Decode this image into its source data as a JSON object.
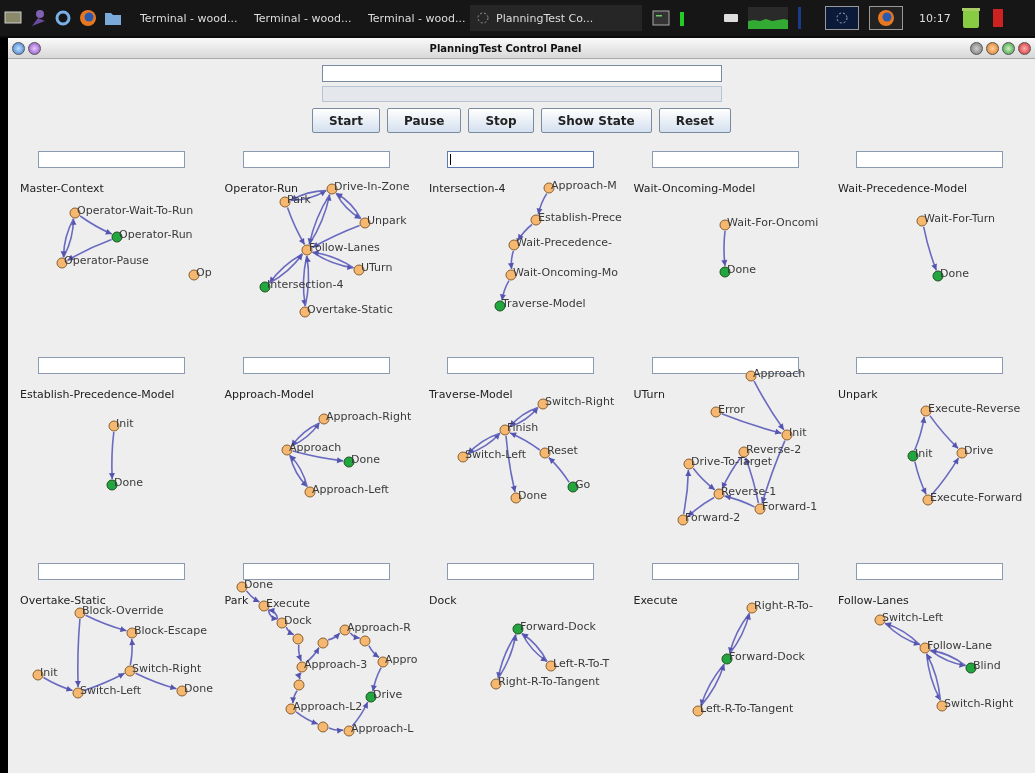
{
  "taskbar": {
    "tasks": [
      {
        "label": "Terminal - wood...",
        "kind": "terminal",
        "selected": false
      },
      {
        "label": "Terminal - wood...",
        "kind": "terminal",
        "selected": false
      },
      {
        "label": "Terminal - wood...",
        "kind": "terminal",
        "selected": false
      },
      {
        "label": "PlanningTest Co...",
        "kind": "java",
        "selected": true
      }
    ],
    "clock": "10:17"
  },
  "window": {
    "title": "PlanningTest Control Panel"
  },
  "buttons": [
    "Start",
    "Pause",
    "Stop",
    "Show State",
    "Reset"
  ],
  "panels": [
    {
      "title": "Master-Context",
      "field_focused": false,
      "nodes": [
        {
          "label": "Operator-Wait-To-Run",
          "active": false
        },
        {
          "label": "Operator-Run",
          "active": true
        },
        {
          "label": "Operator-Pause",
          "active": false
        },
        {
          "label": "Op",
          "active": false
        }
      ]
    },
    {
      "title": "Operator-Run",
      "field_focused": false,
      "nodes": [
        {
          "label": "Park",
          "active": false
        },
        {
          "label": "Drive-In-Zone",
          "active": false
        },
        {
          "label": "Unpark",
          "active": false
        },
        {
          "label": "Follow-Lanes",
          "active": false
        },
        {
          "label": "UTurn",
          "active": false
        },
        {
          "label": "Intersection-4",
          "active": true
        },
        {
          "label": "Overtake-Static",
          "active": false
        }
      ]
    },
    {
      "title": "Intersection-4",
      "field_focused": true,
      "nodes": [
        {
          "label": "Approach-M",
          "active": false
        },
        {
          "label": "Establish-Prece",
          "active": false
        },
        {
          "label": "Wait-Precedence-",
          "active": false
        },
        {
          "label": "Wait-Oncoming-Mo",
          "active": false
        },
        {
          "label": "Traverse-Model",
          "active": true
        }
      ]
    },
    {
      "title": "Wait-Oncoming-Model",
      "field_focused": false,
      "nodes": [
        {
          "label": "Wait-For-Oncomi",
          "active": false
        },
        {
          "label": "Done",
          "active": true
        }
      ]
    },
    {
      "title": "Wait-Precedence-Model",
      "field_focused": false,
      "nodes": [
        {
          "label": "Wait-For-Turn",
          "active": false
        },
        {
          "label": "Done",
          "active": true
        }
      ]
    },
    {
      "title": "Establish-Precedence-Model",
      "field_focused": false,
      "nodes": [
        {
          "label": "Init",
          "active": false
        },
        {
          "label": "Done",
          "active": true
        }
      ]
    },
    {
      "title": "Approach-Model",
      "field_focused": false,
      "nodes": [
        {
          "label": "Approach-Right",
          "active": false
        },
        {
          "label": "Approach",
          "active": false
        },
        {
          "label": "Done",
          "active": true
        },
        {
          "label": "Approach-Left",
          "active": false
        }
      ]
    },
    {
      "title": "Traverse-Model",
      "field_focused": false,
      "nodes": [
        {
          "label": "Switch-Right",
          "active": false
        },
        {
          "label": "Finish",
          "active": false
        },
        {
          "label": "Switch-Left",
          "active": false
        },
        {
          "label": "Reset",
          "active": false
        },
        {
          "label": "Done",
          "active": false
        },
        {
          "label": "Go",
          "active": true
        }
      ]
    },
    {
      "title": "UTurn",
      "field_focused": false,
      "nodes": [
        {
          "label": "Approach",
          "active": false
        },
        {
          "label": "Error",
          "active": false
        },
        {
          "label": "Init",
          "active": false
        },
        {
          "label": "Drive-To-Target",
          "active": false
        },
        {
          "label": "Reverse-2",
          "active": false
        },
        {
          "label": "Reverse-1",
          "active": false
        },
        {
          "label": "Forward-1",
          "active": false
        },
        {
          "label": "Forward-2",
          "active": false
        }
      ]
    },
    {
      "title": "Unpark",
      "field_focused": false,
      "nodes": [
        {
          "label": "Execute-Reverse",
          "active": false
        },
        {
          "label": "Init",
          "active": true
        },
        {
          "label": "Drive",
          "active": false
        },
        {
          "label": "Execute-Forward",
          "active": false
        }
      ]
    },
    {
      "title": "Overtake-Static",
      "field_focused": false,
      "nodes": [
        {
          "label": "Block-Override",
          "active": false
        },
        {
          "label": "Block-Escape",
          "active": false
        },
        {
          "label": "Init",
          "active": false
        },
        {
          "label": "Switch-Left",
          "active": false
        },
        {
          "label": "Switch-Right",
          "active": false
        },
        {
          "label": "Done",
          "active": false
        }
      ]
    },
    {
      "title": "Park",
      "field_focused": false,
      "nodes": [
        {
          "label": "Done",
          "active": false
        },
        {
          "label": "Execute",
          "active": false
        },
        {
          "label": "Dock",
          "active": false
        },
        {
          "active": false
        },
        {
          "label": "Approach-3",
          "active": false
        },
        {
          "active": false
        },
        {
          "label": "Approach-R",
          "active": false
        },
        {
          "active": false
        },
        {
          "label": "Appro",
          "active": false
        },
        {
          "label": "Drive",
          "active": true
        },
        {
          "active": false
        },
        {
          "label": "Approach-L2",
          "active": false
        },
        {
          "active": false
        },
        {
          "label": "Approach-L",
          "active": false
        }
      ]
    },
    {
      "title": "Dock",
      "field_focused": false,
      "nodes": [
        {
          "label": "Forward-Dock",
          "active": true
        },
        {
          "label": "Left-R-To-T",
          "active": false
        },
        {
          "label": "Right-R-To-Tangent",
          "active": false
        }
      ]
    },
    {
      "title": "Execute",
      "field_focused": false,
      "nodes": [
        {
          "label": "Right-R-To-",
          "active": false
        },
        {
          "label": "Forward-Dock",
          "active": true
        },
        {
          "label": "Left-R-To-Tangent",
          "active": false
        }
      ]
    },
    {
      "title": "Follow-Lanes",
      "field_focused": false,
      "nodes": [
        {
          "label": "Switch-Left",
          "active": false
        },
        {
          "label": "Follow-Lane",
          "active": false
        },
        {
          "label": "Blind",
          "active": true
        },
        {
          "label": "Switch-Right",
          "active": false
        }
      ]
    }
  ]
}
